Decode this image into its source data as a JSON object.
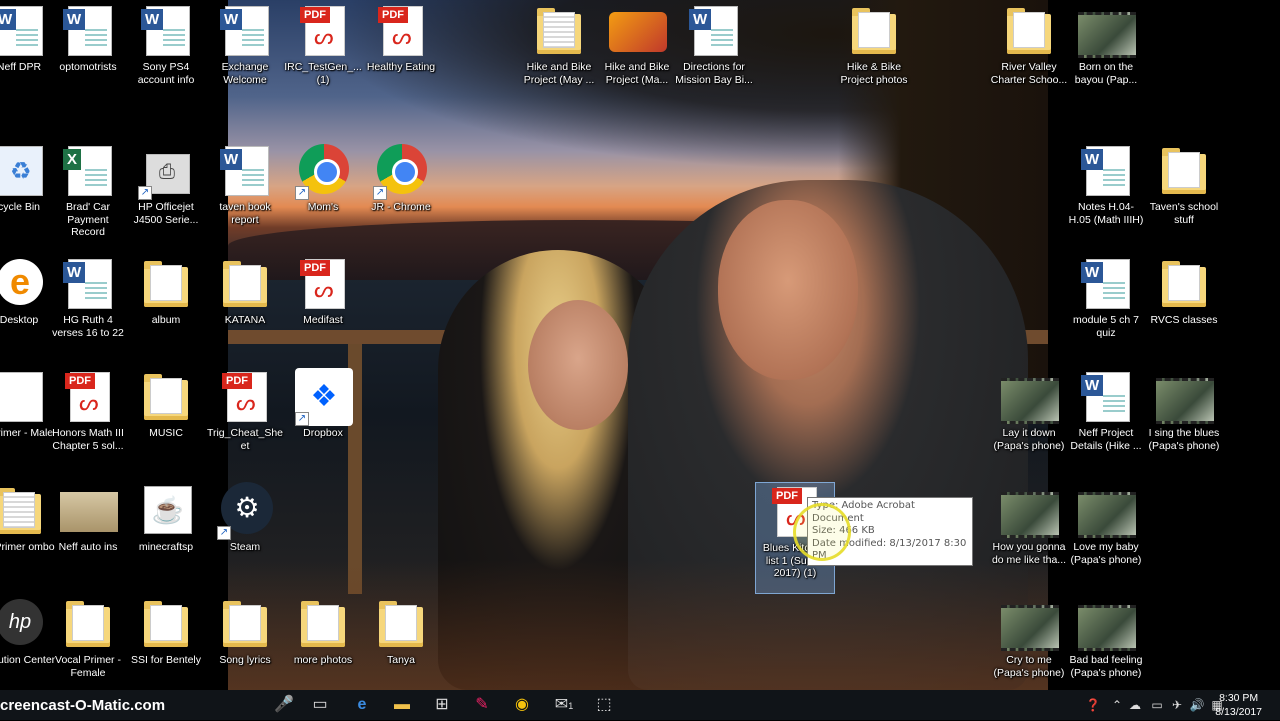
{
  "desktop": {
    "icons": [
      {
        "label": "Neff DPR",
        "kind": "word"
      },
      {
        "label": "optomotrists",
        "kind": "word"
      },
      {
        "label": "Sony PS4 account info",
        "kind": "word"
      },
      {
        "label": "Exchange Welcome",
        "kind": "word"
      },
      {
        "label": "IRC_TestGen_... (1)",
        "kind": "pdf"
      },
      {
        "label": "Healthy Eating",
        "kind": "pdf"
      },
      {
        "label": "Hike and Bike Project (May ...",
        "kind": "zipfolder"
      },
      {
        "label": "Hike and Bike Project (Ma...",
        "kind": "film"
      },
      {
        "label": "Directions for Mission Bay Bi...",
        "kind": "word"
      },
      {
        "label": "Hike & Bike Project photos",
        "kind": "folder"
      },
      {
        "label": "River Valley Charter Schoo...",
        "kind": "folder"
      },
      {
        "label": "Born on the bayou (Pap...",
        "kind": "video"
      },
      {
        "label": "cycle Bin",
        "kind": "recycle"
      },
      {
        "label": "Brad' Car Payment Record",
        "kind": "excel"
      },
      {
        "label": "HP Officejet J4500 Serie...",
        "kind": "printer"
      },
      {
        "label": "taven book report",
        "kind": "word"
      },
      {
        "label": "Mom's",
        "kind": "chrome"
      },
      {
        "label": "JR - Chrome",
        "kind": "chrome"
      },
      {
        "label": "Notes H.04-H.05 (Math IIIH)",
        "kind": "word"
      },
      {
        "label": "Taven's school stuff",
        "kind": "folder"
      },
      {
        "label": "Desktop",
        "kind": "edge"
      },
      {
        "label": "HG Ruth 4 verses 16 to 22",
        "kind": "word"
      },
      {
        "label": "album",
        "kind": "folder"
      },
      {
        "label": "KATANA",
        "kind": "folder"
      },
      {
        "label": "Medifast",
        "kind": "pdf"
      },
      {
        "label": "module 5 ch 7 quiz",
        "kind": "word"
      },
      {
        "label": "RVCS classes",
        "kind": "folder"
      },
      {
        "label": "l Primer - Male",
        "kind": "doc"
      },
      {
        "label": "Honors Math III Chapter 5 sol...",
        "kind": "pdf"
      },
      {
        "label": "MUSIC",
        "kind": "folder"
      },
      {
        "label": "Trig_Cheat_Sheet",
        "kind": "pdf"
      },
      {
        "label": "Dropbox",
        "kind": "dropbox"
      },
      {
        "label": "Lay it down (Papa's phone)",
        "kind": "video"
      },
      {
        "label": "Neff Project Details (Hike ...",
        "kind": "word"
      },
      {
        "label": "I sing the blues (Papa's phone)",
        "kind": "video"
      },
      {
        "label": "al Primer ombo",
        "kind": "zipfolder"
      },
      {
        "label": "Neff auto ins",
        "kind": "image"
      },
      {
        "label": "minecraftsp",
        "kind": "java"
      },
      {
        "label": "Steam",
        "kind": "steam"
      },
      {
        "label": "Blues Kitchen list 1 (Sum... 2017) (1)",
        "kind": "pdf"
      },
      {
        "label": "How you gonna do me like tha...",
        "kind": "video"
      },
      {
        "label": "Love my baby (Papa's phone)",
        "kind": "video"
      },
      {
        "label": "Solution Center",
        "kind": "hp"
      },
      {
        "label": "Vocal Primer - Female",
        "kind": "folder"
      },
      {
        "label": "SSI for Bentely",
        "kind": "folder"
      },
      {
        "label": "Song lyrics",
        "kind": "folder"
      },
      {
        "label": "more photos",
        "kind": "folder"
      },
      {
        "label": "Tanya",
        "kind": "folder"
      },
      {
        "label": "Cry to me (Papa's phone)",
        "kind": "video"
      },
      {
        "label": "Bad bad feeling (Papa's phone)",
        "kind": "video"
      }
    ]
  },
  "tooltip": {
    "type": "Type: Adobe Acrobat Document",
    "size": "Size: 466 KB",
    "modified": "Date modified: 8/13/2017 8:30 PM"
  },
  "taskbar": {
    "watermark": "creencast-O-Matic.com",
    "time": "8:30 PM",
    "date": "8/13/2017",
    "mail_badge": "1"
  }
}
